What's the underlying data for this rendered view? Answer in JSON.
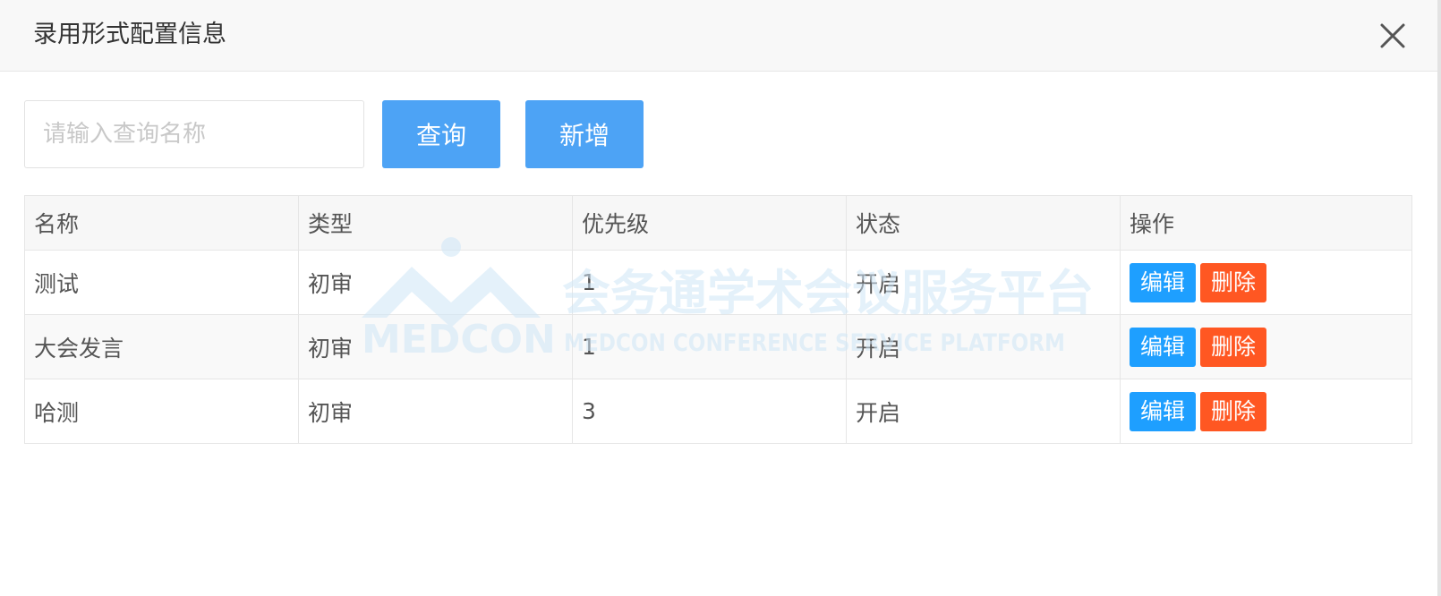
{
  "dialog": {
    "title": "录用形式配置信息",
    "close_icon": "close-icon"
  },
  "toolbar": {
    "search_placeholder": "请输入查询名称",
    "search_value": "",
    "query_label": "查询",
    "add_label": "新增"
  },
  "table": {
    "headers": [
      "名称",
      "类型",
      "优先级",
      "状态",
      "操作"
    ],
    "rows": [
      {
        "name": "测试",
        "type": "初审",
        "priority": "1",
        "status": "开启",
        "edit": "编辑",
        "delete": "删除"
      },
      {
        "name": "大会发言",
        "type": "初审",
        "priority": "1",
        "status": "开启",
        "edit": "编辑",
        "delete": "删除"
      },
      {
        "name": "哈测",
        "type": "初审",
        "priority": "3",
        "status": "开启",
        "edit": "编辑",
        "delete": "删除"
      }
    ]
  },
  "watermark": {
    "logo_text": "MEDCON",
    "cn_text": "会务通学术会议服务平台",
    "en_text": "MEDCON CONFERENCE SERVICE PLATFORM"
  },
  "colors": {
    "primary_button": "#4da3f5",
    "edit_button": "#1e9fff",
    "delete_button": "#ff5722",
    "watermark": "#cfe6f7"
  }
}
